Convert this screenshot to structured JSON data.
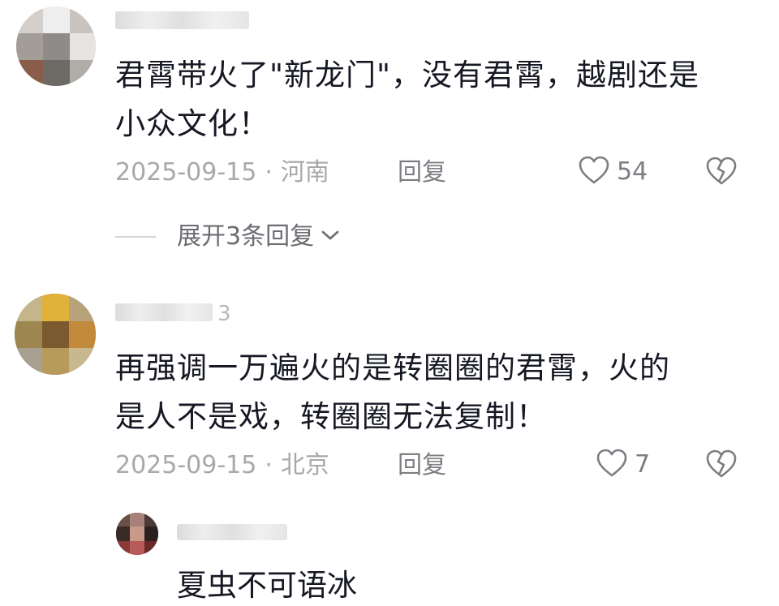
{
  "comments": [
    {
      "username_tail": "",
      "text_line1": "君霄带火了\"新龙门\"，没有君霄，越剧还是",
      "text_line2": "小众文化！",
      "date": "2025-09-15",
      "separator": "·",
      "location": "河南",
      "reply_label": "回复",
      "likes": "54",
      "expand_label": "展开3条回复"
    },
    {
      "username_tail": "3",
      "text_line1": "再强调一万遍火的是转圈圈的君霄，火的",
      "text_line2": "是人不是戏，转圈圈无法复制！",
      "date": "2025-09-15",
      "separator": "·",
      "location": "北京",
      "reply_label": "回复",
      "likes": "7"
    }
  ],
  "sub_reply": {
    "text": "夏虫不可语冰"
  },
  "colors": {
    "text": "#161823",
    "meta": "#a8a8ad",
    "action": "#7d7d83"
  },
  "icons": {
    "like": "heart-outline-icon",
    "dislike": "broken-heart-icon",
    "expand": "chevron-down-icon"
  }
}
